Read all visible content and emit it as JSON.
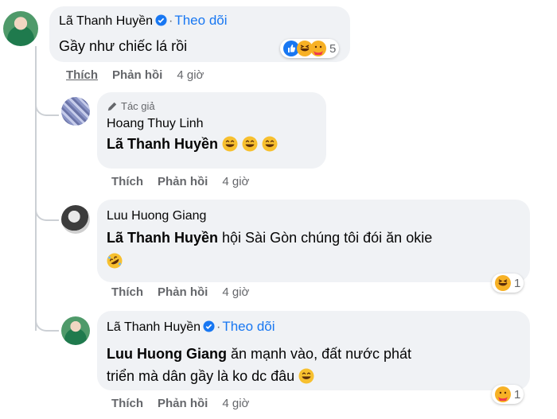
{
  "comments": [
    {
      "name": "Lã Thanh Huyền",
      "follow_label": "Theo dõi",
      "text": "Gầy như chiếc lá rồi",
      "reaction_count": "5",
      "actions": {
        "like": "Thích",
        "reply": "Phản hồi",
        "time": "4 giờ"
      }
    },
    {
      "author_tag": "Tác giả",
      "name": "Hoang Thuy Linh",
      "mention": "Lã Thanh Huyền",
      "actions": {
        "like": "Thích",
        "reply": "Phản hồi",
        "time": "4 giờ"
      }
    },
    {
      "name": "Luu Huong Giang",
      "mention": "Lã Thanh Huyền",
      "text": "hội Sài Gòn chúng tôi đói ăn okie",
      "reaction_count": "1",
      "actions": {
        "like": "Thích",
        "reply": "Phản hồi",
        "time": "4 giờ"
      }
    },
    {
      "name": "Lã Thanh Huyền",
      "follow_label": "Theo dõi",
      "mention": "Luu Huong Giang",
      "text_line1": "ăn mạnh vào, đất nước phát",
      "text_line2": "triển mà dân gầy là ko dc đâu",
      "reaction_count": "1",
      "actions": {
        "like": "Thích",
        "reply": "Phản hồi",
        "time": "4 giờ"
      }
    }
  ],
  "colors": {
    "bubble": "#f0f2f5",
    "link": "#1877f2",
    "meta": "#65676b",
    "thread_line": "#ccd0d5"
  },
  "icons": [
    "verified-badge-icon",
    "like-reaction-icon",
    "haha-reaction-icon",
    "care-reaction-icon",
    "grinning-emoji-icon",
    "rofl-emoji-icon",
    "pencil-icon"
  ]
}
